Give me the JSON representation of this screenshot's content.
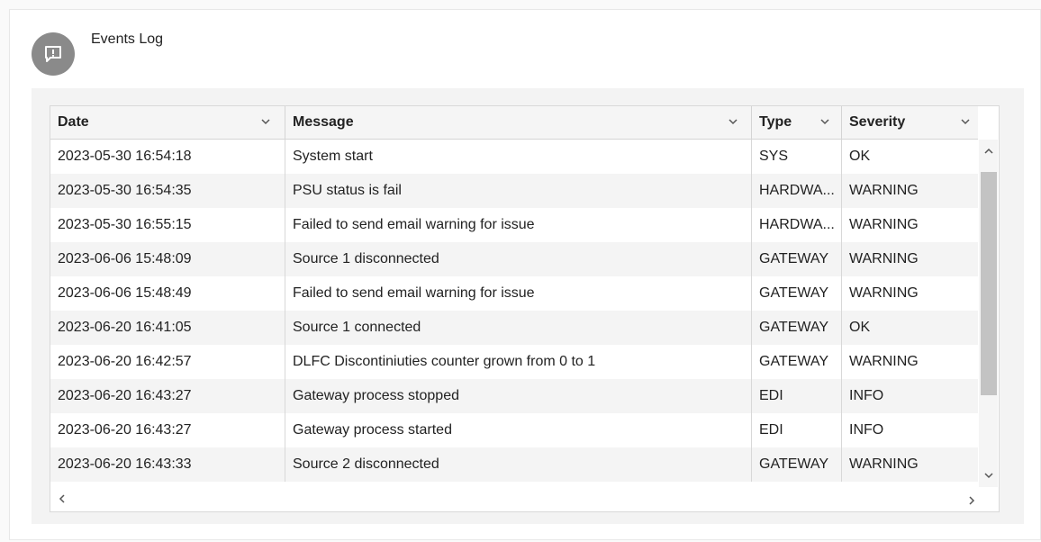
{
  "panel": {
    "title": "Events Log",
    "icon": "alert-message-icon"
  },
  "table": {
    "columns": [
      "Date",
      "Message",
      "Type",
      "Severity"
    ],
    "rows": [
      [
        "2023-05-30 16:54:18",
        "System start",
        "SYS",
        "OK"
      ],
      [
        "2023-05-30 16:54:35",
        "PSU status is fail",
        "HARDWA...",
        "WARNING"
      ],
      [
        "2023-05-30 16:55:15",
        "Failed to send email warning for issue",
        "HARDWA...",
        "WARNING"
      ],
      [
        "2023-06-06 15:48:09",
        "Source 1 disconnected",
        "GATEWAY",
        "WARNING"
      ],
      [
        "2023-06-06 15:48:49",
        "Failed to send email warning for issue",
        "GATEWAY",
        "WARNING"
      ],
      [
        "2023-06-20 16:41:05",
        "Source 1 connected",
        "GATEWAY",
        "OK"
      ],
      [
        "2023-06-20 16:42:57",
        "DLFC Discontiniuties counter grown from 0 to 1",
        "GATEWAY",
        "WARNING"
      ],
      [
        "2023-06-20 16:43:27",
        "Gateway process stopped",
        "EDI",
        "INFO"
      ],
      [
        "2023-06-20 16:43:27",
        "Gateway process started",
        "EDI",
        "INFO"
      ],
      [
        "2023-06-20 16:43:33",
        "Source 2 disconnected",
        "GATEWAY",
        "WARNING"
      ]
    ]
  },
  "colors": {
    "avatar": "#8a8a8a",
    "header_bg": "#f5f5f5",
    "row_alt": "#f4f4f4",
    "scroll_thumb": "#c3c3c3"
  }
}
